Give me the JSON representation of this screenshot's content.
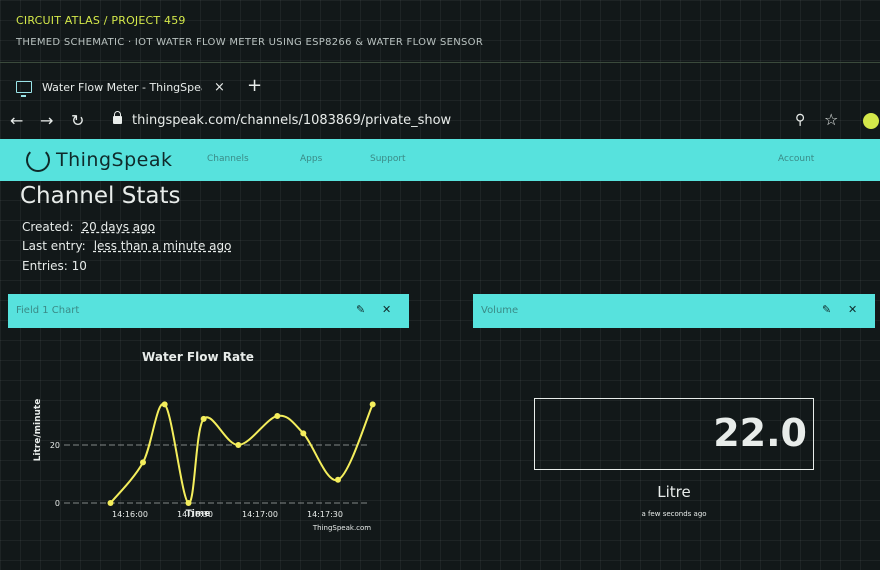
{
  "header": {
    "brand": "CIRCUIT ATLAS / PROJECT 459",
    "subtitle": "THEMED SCHEMATIC · IOT WATER FLOW METER USING ESP8266 & WATER FLOW SENSOR"
  },
  "browser": {
    "tab_title": "Water Flow Meter - ThingSpeak",
    "tab_close": "×",
    "new_tab": "+",
    "url": "thingspeak.com/channels/1083869/private_show",
    "back": "←",
    "forward": "→",
    "reload": "↻",
    "zoom_icon": "⚲",
    "star_icon": "☆"
  },
  "site_nav": {
    "logo": "ThingSpeak",
    "menu": [
      "Channels",
      "Apps",
      "Support"
    ],
    "right": "Account"
  },
  "channel_stats": {
    "title": "Channel Stats",
    "created_label": "Created:",
    "created_value": "20 days ago",
    "last_entry_label": "Last entry:",
    "last_entry_value": "less than a minute ago",
    "entries_label": "Entries:",
    "entries_value": "10"
  },
  "widgets": {
    "chart": {
      "title": "Field 1 Chart",
      "edit": "✎",
      "close": "✕"
    },
    "volume": {
      "title": "Volume",
      "edit": "✎",
      "close": "✕"
    }
  },
  "volume_display": {
    "value": "22.0",
    "unit": "Litre",
    "updated": "a few seconds ago"
  },
  "chart_data": {
    "type": "line",
    "title": "Water Flow Rate",
    "xlabel": "Time",
    "ylabel": "Litre/minute",
    "credit": "ThingSpeak.com",
    "x_ticks": [
      "14:16:00",
      "14:16:30",
      "14:17:00",
      "14:17:30"
    ],
    "y_ticks": [
      0,
      20
    ],
    "ylim": [
      0,
      40
    ],
    "series_color": "#f4ee5c",
    "points": [
      {
        "t": "14:15:51",
        "y": 0
      },
      {
        "t": "14:16:06",
        "y": 14
      },
      {
        "t": "14:16:16",
        "y": 34
      },
      {
        "t": "14:16:27",
        "y": 0
      },
      {
        "t": "14:16:34",
        "y": 29
      },
      {
        "t": "14:16:50",
        "y": 20
      },
      {
        "t": "14:17:08",
        "y": 30
      },
      {
        "t": "14:17:20",
        "y": 24
      },
      {
        "t": "14:17:36",
        "y": 8
      },
      {
        "t": "14:17:52",
        "y": 34
      }
    ]
  }
}
